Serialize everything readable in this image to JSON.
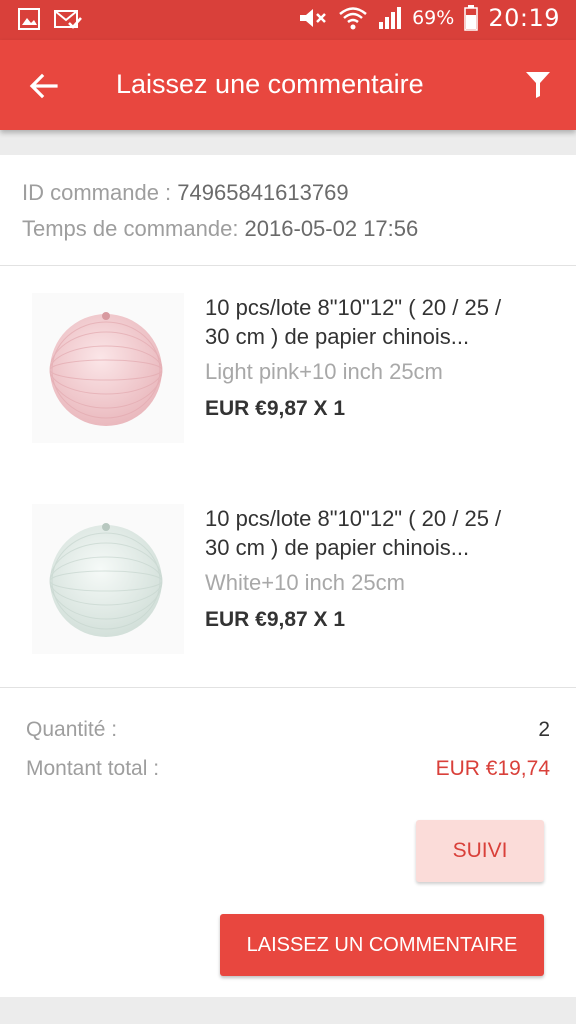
{
  "status_bar": {
    "battery_pct": "69%",
    "time": "20:19",
    "icons": [
      "gallery-icon",
      "mail-check-icon",
      "mute-icon",
      "wifi-icon",
      "signal-icon",
      "battery-icon"
    ]
  },
  "app_bar": {
    "title": "Laissez une commentaire",
    "back_icon": "arrow-left-icon",
    "filter_icon": "filter-icon"
  },
  "order": {
    "id_label": "ID commande : ",
    "id_value": "74965841613769",
    "time_label": "Temps de commande: ",
    "time_value": "2016-05-02 17:56"
  },
  "items": [
    {
      "title_line1": "10 pcs/lote 8\"10\"12\" ( 20 / 25 /",
      "title_line2": "30 cm ) de papier chinois...",
      "variant": "Light pink+10 inch 25cm",
      "price": "EUR €9,87 X 1",
      "color": "#f2c9cc"
    },
    {
      "title_line1": "10 pcs/lote 8\"10\"12\" ( 20 / 25 /",
      "title_line2": "30 cm ) de papier chinois...",
      "variant": "White+10 inch 25cm",
      "price": "EUR €9,87 X 1",
      "color": "#e8efec"
    }
  ],
  "summary": {
    "qty_label": "Quantité :",
    "qty_value": "2",
    "total_label": "Montant total :",
    "total_value": "EUR €19,74"
  },
  "buttons": {
    "suivi": "SUIVI",
    "comment": "LAISSEZ UN COMMENTAIRE"
  },
  "colors": {
    "status_bar": "#d9403a",
    "app_bar": "#e8473f",
    "accent": "#d9403a"
  }
}
